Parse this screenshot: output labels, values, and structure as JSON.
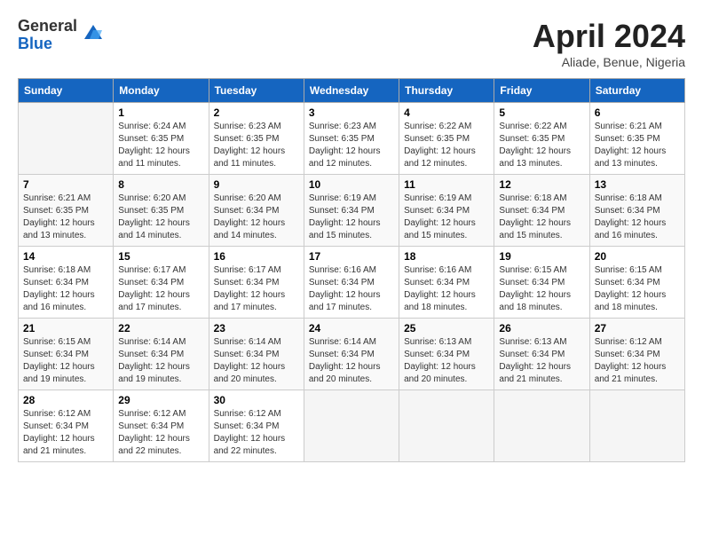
{
  "header": {
    "logo_general": "General",
    "logo_blue": "Blue",
    "month_title": "April 2024",
    "location": "Aliade, Benue, Nigeria"
  },
  "days_of_week": [
    "Sunday",
    "Monday",
    "Tuesday",
    "Wednesday",
    "Thursday",
    "Friday",
    "Saturday"
  ],
  "weeks": [
    [
      {
        "day": "",
        "sunrise": "",
        "sunset": "",
        "daylight": ""
      },
      {
        "day": "1",
        "sunrise": "Sunrise: 6:24 AM",
        "sunset": "Sunset: 6:35 PM",
        "daylight": "Daylight: 12 hours and 11 minutes."
      },
      {
        "day": "2",
        "sunrise": "Sunrise: 6:23 AM",
        "sunset": "Sunset: 6:35 PM",
        "daylight": "Daylight: 12 hours and 11 minutes."
      },
      {
        "day": "3",
        "sunrise": "Sunrise: 6:23 AM",
        "sunset": "Sunset: 6:35 PM",
        "daylight": "Daylight: 12 hours and 12 minutes."
      },
      {
        "day": "4",
        "sunrise": "Sunrise: 6:22 AM",
        "sunset": "Sunset: 6:35 PM",
        "daylight": "Daylight: 12 hours and 12 minutes."
      },
      {
        "day": "5",
        "sunrise": "Sunrise: 6:22 AM",
        "sunset": "Sunset: 6:35 PM",
        "daylight": "Daylight: 12 hours and 13 minutes."
      },
      {
        "day": "6",
        "sunrise": "Sunrise: 6:21 AM",
        "sunset": "Sunset: 6:35 PM",
        "daylight": "Daylight: 12 hours and 13 minutes."
      }
    ],
    [
      {
        "day": "7",
        "sunrise": "Sunrise: 6:21 AM",
        "sunset": "Sunset: 6:35 PM",
        "daylight": "Daylight: 12 hours and 13 minutes."
      },
      {
        "day": "8",
        "sunrise": "Sunrise: 6:20 AM",
        "sunset": "Sunset: 6:35 PM",
        "daylight": "Daylight: 12 hours and 14 minutes."
      },
      {
        "day": "9",
        "sunrise": "Sunrise: 6:20 AM",
        "sunset": "Sunset: 6:34 PM",
        "daylight": "Daylight: 12 hours and 14 minutes."
      },
      {
        "day": "10",
        "sunrise": "Sunrise: 6:19 AM",
        "sunset": "Sunset: 6:34 PM",
        "daylight": "Daylight: 12 hours and 15 minutes."
      },
      {
        "day": "11",
        "sunrise": "Sunrise: 6:19 AM",
        "sunset": "Sunset: 6:34 PM",
        "daylight": "Daylight: 12 hours and 15 minutes."
      },
      {
        "day": "12",
        "sunrise": "Sunrise: 6:18 AM",
        "sunset": "Sunset: 6:34 PM",
        "daylight": "Daylight: 12 hours and 15 minutes."
      },
      {
        "day": "13",
        "sunrise": "Sunrise: 6:18 AM",
        "sunset": "Sunset: 6:34 PM",
        "daylight": "Daylight: 12 hours and 16 minutes."
      }
    ],
    [
      {
        "day": "14",
        "sunrise": "Sunrise: 6:18 AM",
        "sunset": "Sunset: 6:34 PM",
        "daylight": "Daylight: 12 hours and 16 minutes."
      },
      {
        "day": "15",
        "sunrise": "Sunrise: 6:17 AM",
        "sunset": "Sunset: 6:34 PM",
        "daylight": "Daylight: 12 hours and 17 minutes."
      },
      {
        "day": "16",
        "sunrise": "Sunrise: 6:17 AM",
        "sunset": "Sunset: 6:34 PM",
        "daylight": "Daylight: 12 hours and 17 minutes."
      },
      {
        "day": "17",
        "sunrise": "Sunrise: 6:16 AM",
        "sunset": "Sunset: 6:34 PM",
        "daylight": "Daylight: 12 hours and 17 minutes."
      },
      {
        "day": "18",
        "sunrise": "Sunrise: 6:16 AM",
        "sunset": "Sunset: 6:34 PM",
        "daylight": "Daylight: 12 hours and 18 minutes."
      },
      {
        "day": "19",
        "sunrise": "Sunrise: 6:15 AM",
        "sunset": "Sunset: 6:34 PM",
        "daylight": "Daylight: 12 hours and 18 minutes."
      },
      {
        "day": "20",
        "sunrise": "Sunrise: 6:15 AM",
        "sunset": "Sunset: 6:34 PM",
        "daylight": "Daylight: 12 hours and 18 minutes."
      }
    ],
    [
      {
        "day": "21",
        "sunrise": "Sunrise: 6:15 AM",
        "sunset": "Sunset: 6:34 PM",
        "daylight": "Daylight: 12 hours and 19 minutes."
      },
      {
        "day": "22",
        "sunrise": "Sunrise: 6:14 AM",
        "sunset": "Sunset: 6:34 PM",
        "daylight": "Daylight: 12 hours and 19 minutes."
      },
      {
        "day": "23",
        "sunrise": "Sunrise: 6:14 AM",
        "sunset": "Sunset: 6:34 PM",
        "daylight": "Daylight: 12 hours and 20 minutes."
      },
      {
        "day": "24",
        "sunrise": "Sunrise: 6:14 AM",
        "sunset": "Sunset: 6:34 PM",
        "daylight": "Daylight: 12 hours and 20 minutes."
      },
      {
        "day": "25",
        "sunrise": "Sunrise: 6:13 AM",
        "sunset": "Sunset: 6:34 PM",
        "daylight": "Daylight: 12 hours and 20 minutes."
      },
      {
        "day": "26",
        "sunrise": "Sunrise: 6:13 AM",
        "sunset": "Sunset: 6:34 PM",
        "daylight": "Daylight: 12 hours and 21 minutes."
      },
      {
        "day": "27",
        "sunrise": "Sunrise: 6:12 AM",
        "sunset": "Sunset: 6:34 PM",
        "daylight": "Daylight: 12 hours and 21 minutes."
      }
    ],
    [
      {
        "day": "28",
        "sunrise": "Sunrise: 6:12 AM",
        "sunset": "Sunset: 6:34 PM",
        "daylight": "Daylight: 12 hours and 21 minutes."
      },
      {
        "day": "29",
        "sunrise": "Sunrise: 6:12 AM",
        "sunset": "Sunset: 6:34 PM",
        "daylight": "Daylight: 12 hours and 22 minutes."
      },
      {
        "day": "30",
        "sunrise": "Sunrise: 6:12 AM",
        "sunset": "Sunset: 6:34 PM",
        "daylight": "Daylight: 12 hours and 22 minutes."
      },
      {
        "day": "",
        "sunrise": "",
        "sunset": "",
        "daylight": ""
      },
      {
        "day": "",
        "sunrise": "",
        "sunset": "",
        "daylight": ""
      },
      {
        "day": "",
        "sunrise": "",
        "sunset": "",
        "daylight": ""
      },
      {
        "day": "",
        "sunrise": "",
        "sunset": "",
        "daylight": ""
      }
    ]
  ]
}
